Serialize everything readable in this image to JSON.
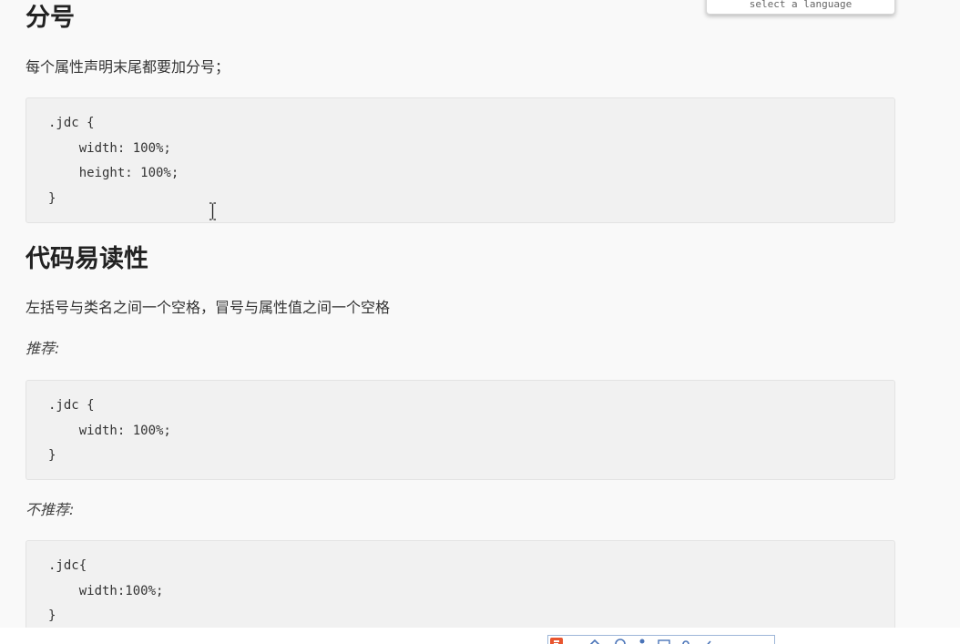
{
  "language_popup": {
    "label": "select a language"
  },
  "sections": {
    "semicolon": {
      "title": "分号",
      "description": "每个属性声明末尾都要加分号；",
      "code": [
        ".jdc {",
        "    width: 100%;",
        "    height: 100%;",
        "}"
      ]
    },
    "readability": {
      "title": "代码易读性",
      "description": "左括号与类名之间一个空格，冒号与属性值之间一个空格",
      "recommended_label": "推荐:",
      "recommended_code": [
        ".jdc {",
        "    width: 100%;",
        "}"
      ],
      "not_recommended_label": "不推荐:",
      "not_recommended_code": [
        ".jdc{",
        "    width:100%;",
        "}"
      ]
    }
  },
  "icons": {
    "cursor": "text-cursor-icon",
    "toolbar": [
      "app-logo-icon",
      "keyboard-icon",
      "microphone-icon",
      "person-icon",
      "grid-icon",
      "settings-icon",
      "skin-icon"
    ]
  },
  "colors": {
    "background": "#f9f9f9",
    "code_background": "#f1f1f1",
    "logo": "#e8552f"
  }
}
